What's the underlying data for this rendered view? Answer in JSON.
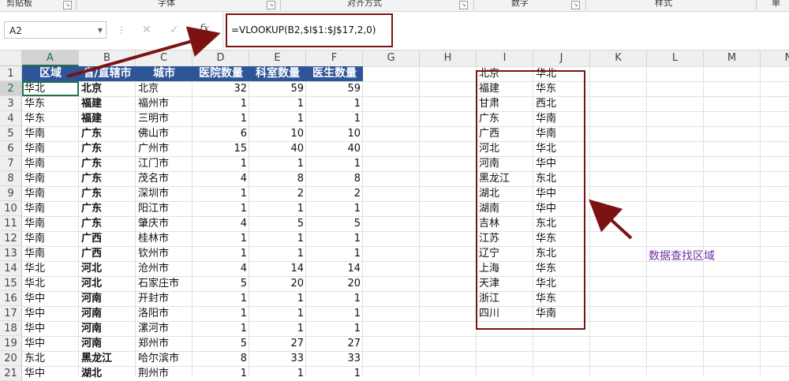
{
  "ribbon": {
    "groups": [
      {
        "label": "剪贴板"
      },
      {
        "label": "字体"
      },
      {
        "label": "对齐方式"
      },
      {
        "label": "数字"
      },
      {
        "label": "样式"
      },
      {
        "label": "单"
      }
    ]
  },
  "formula_bar": {
    "name_box": "A2",
    "fx_label": "fx",
    "formula": "=VLOOKUP(B2,$I$1:$J$17,2,0)"
  },
  "columns": [
    "A",
    "B",
    "C",
    "D",
    "E",
    "F",
    "G",
    "H",
    "I",
    "J",
    "K",
    "L",
    "M",
    "N"
  ],
  "rows": [
    "1",
    "2",
    "3",
    "4",
    "5",
    "6",
    "7",
    "8",
    "9",
    "10",
    "11",
    "12",
    "13",
    "14",
    "15",
    "16",
    "17",
    "18",
    "19",
    "20",
    "21"
  ],
  "table": {
    "headers": [
      "区域",
      "省/直辖市",
      "城市",
      "医院数量",
      "科室数量",
      "医生数量"
    ],
    "rows": [
      [
        "华北",
        "北京",
        "北京",
        "32",
        "59",
        "59"
      ],
      [
        "华东",
        "福建",
        "福州市",
        "1",
        "1",
        "1"
      ],
      [
        "华东",
        "福建",
        "三明市",
        "1",
        "1",
        "1"
      ],
      [
        "华南",
        "广东",
        "佛山市",
        "6",
        "10",
        "10"
      ],
      [
        "华南",
        "广东",
        "广州市",
        "15",
        "40",
        "40"
      ],
      [
        "华南",
        "广东",
        "江门市",
        "1",
        "1",
        "1"
      ],
      [
        "华南",
        "广东",
        "茂名市",
        "4",
        "8",
        "8"
      ],
      [
        "华南",
        "广东",
        "深圳市",
        "1",
        "2",
        "2"
      ],
      [
        "华南",
        "广东",
        "阳江市",
        "1",
        "1",
        "1"
      ],
      [
        "华南",
        "广东",
        "肇庆市",
        "4",
        "5",
        "5"
      ],
      [
        "华南",
        "广西",
        "桂林市",
        "1",
        "1",
        "1"
      ],
      [
        "华南",
        "广西",
        "钦州市",
        "1",
        "1",
        "1"
      ],
      [
        "华北",
        "河北",
        "沧州市",
        "4",
        "14",
        "14"
      ],
      [
        "华北",
        "河北",
        "石家庄市",
        "5",
        "20",
        "20"
      ],
      [
        "华中",
        "河南",
        "开封市",
        "1",
        "1",
        "1"
      ],
      [
        "华中",
        "河南",
        "洛阳市",
        "1",
        "1",
        "1"
      ],
      [
        "华中",
        "河南",
        "漯河市",
        "1",
        "1",
        "1"
      ],
      [
        "华中",
        "河南",
        "郑州市",
        "5",
        "27",
        "27"
      ],
      [
        "东北",
        "黑龙江",
        "哈尔滨市",
        "8",
        "33",
        "33"
      ],
      [
        "华中",
        "湖北",
        "荆州市",
        "1",
        "1",
        "1"
      ]
    ]
  },
  "lookup": [
    [
      "北京",
      "华北"
    ],
    [
      "福建",
      "华东"
    ],
    [
      "甘肃",
      "西北"
    ],
    [
      "广东",
      "华南"
    ],
    [
      "广西",
      "华南"
    ],
    [
      "河北",
      "华北"
    ],
    [
      "河南",
      "华中"
    ],
    [
      "黑龙江",
      "东北"
    ],
    [
      "湖北",
      "华中"
    ],
    [
      "湖南",
      "华中"
    ],
    [
      "吉林",
      "东北"
    ],
    [
      "江苏",
      "华东"
    ],
    [
      "辽宁",
      "东北"
    ],
    [
      "上海",
      "华东"
    ],
    [
      "天津",
      "华北"
    ],
    [
      "浙江",
      "华东"
    ],
    [
      "四川",
      "华南"
    ]
  ],
  "annotation": "数据查找区域",
  "colors": {
    "header_bg": "#2e5597",
    "annotation_border": "#7b1313",
    "annotation_text": "#7030a0",
    "selection": "#217346"
  }
}
